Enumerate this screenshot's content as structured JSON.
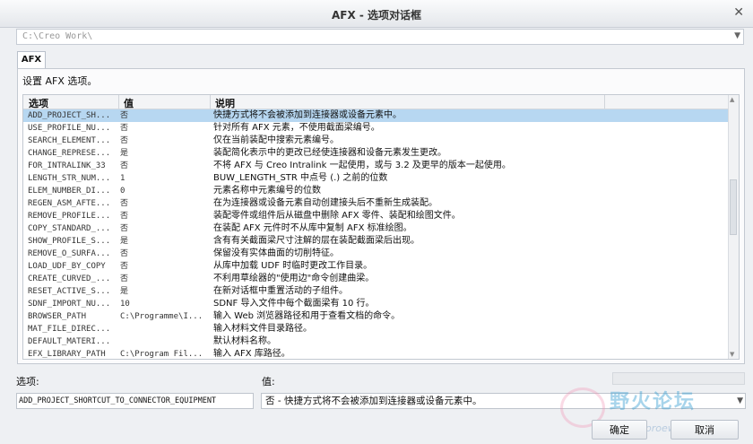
{
  "window": {
    "title": "AFX - 选项对话框"
  },
  "path": {
    "value": "C:\\Creo Work\\"
  },
  "tab": {
    "label": "AFX"
  },
  "panel": {
    "set_label": "设置 AFX 选项。"
  },
  "table": {
    "headers": [
      "选项",
      "值",
      "说明"
    ],
    "rows": [
      {
        "option": "ADD_PROJECT_SH...",
        "value": "否",
        "desc": "快捷方式将不会被添加到连接器或设备元素中。"
      },
      {
        "option": "USE_PROFILE_NU...",
        "value": "否",
        "desc": "针对所有 AFX 元素，不使用截面梁编号。"
      },
      {
        "option": "SEARCH_ELEMENT...",
        "value": "否",
        "desc": "仅在当前装配中搜索元素编号。"
      },
      {
        "option": "CHANGE_REPRESE...",
        "value": "是",
        "desc": "装配简化表示中的更改已经使连接器和设备元素发生更改。"
      },
      {
        "option": "FOR_INTRALINK_33",
        "value": "否",
        "desc": "不将 AFX 与 Creo Intralink 一起使用，或与 3.2 及更早的版本一起使用。"
      },
      {
        "option": "LENGTH_STR_NUM...",
        "value": "1",
        "desc": "BUW_LENGTH_STR 中点号 (.) 之前的位数"
      },
      {
        "option": "ELEM_NUMBER_DI...",
        "value": "0",
        "desc": "元素名称中元素编号的位数"
      },
      {
        "option": "REGEN_ASM_AFTE...",
        "value": "否",
        "desc": "在为连接器或设备元素自动创建接头后不重新生成装配。"
      },
      {
        "option": "REMOVE_PROFILE...",
        "value": "否",
        "desc": "装配零件或组件后从磁盘中删除 AFX 零件、装配和绘图文件。"
      },
      {
        "option": "COPY_STANDARD_...",
        "value": "否",
        "desc": "在装配 AFX 元件时不从库中复制 AFX 标准绘图。"
      },
      {
        "option": "SHOW_PROFILE_S...",
        "value": "是",
        "desc": "含有有关截面梁尺寸注解的层在装配截面梁后出现。"
      },
      {
        "option": "REMOVE_O_SURFA...",
        "value": "否",
        "desc": "保留没有实体曲面的切削特征。"
      },
      {
        "option": "LOAD_UDF_BY_COPY",
        "value": "否",
        "desc": "从库中加载 UDF 时临时更改工作目录。"
      },
      {
        "option": "CREATE_CURVED_...",
        "value": "否",
        "desc": "不利用草绘器的\"使用边\"命令创建曲梁。"
      },
      {
        "option": "RESET_ACTIVE_S...",
        "value": "是",
        "desc": "在新对话框中重置活动的子组件。"
      },
      {
        "option": "SDNF_IMPORT_NU...",
        "value": "10",
        "desc": "SDNF 导入文件中每个截面梁有 10 行。"
      },
      {
        "option": "BROWSER_PATH",
        "value": "C:\\Programme\\I...",
        "desc": "输入 Web 浏览器路径和用于查看文档的命令。"
      },
      {
        "option": "MAT_FILE_DIREC...",
        "value": "",
        "desc": "输入材料文件目录路径。"
      },
      {
        "option": "DEFAULT_MATERI...",
        "value": "",
        "desc": "默认材料名称。"
      },
      {
        "option": "EFX_LIBRARY_PATH",
        "value": "C:\\Program Fil...",
        "desc": "输入 AFX 库路径。"
      }
    ]
  },
  "option_label": "选项:",
  "value_label": "值:",
  "option_field": {
    "value": "ADD_PROJECT_SHORTCUT_TO_CONNECTOR_EQUIPMENT"
  },
  "value_field": {
    "value": "否 - 快捷方式将不会被添加到连接器或设备元素中。"
  },
  "buttons": {
    "ok": "确定",
    "cancel": "取消"
  },
  "watermark": {
    "text": "野火论坛",
    "url": "www.proewildfire.cn"
  }
}
